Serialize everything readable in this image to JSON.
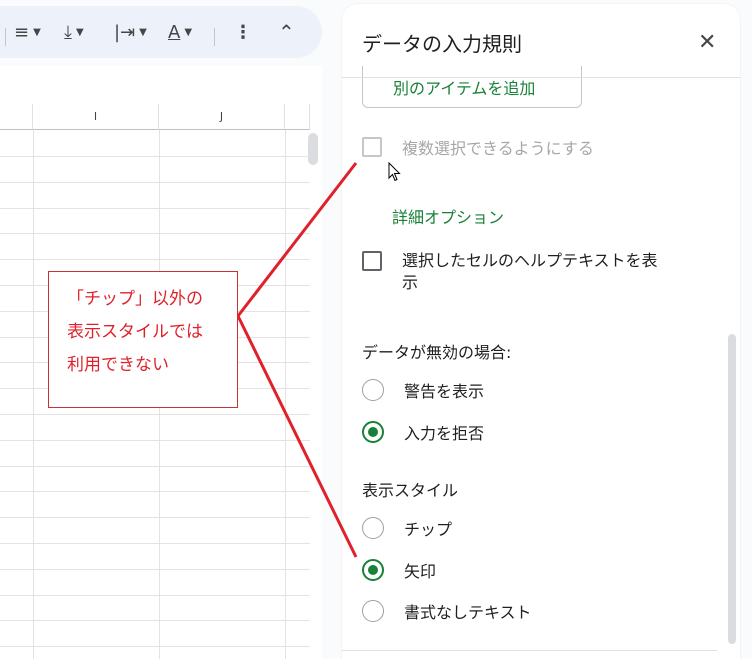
{
  "toolbar": {
    "items": [
      {
        "name": "align-icon",
        "glyph": "≡"
      },
      {
        "name": "vertical-align-icon",
        "glyph": "⤓"
      },
      {
        "name": "text-wrap-icon",
        "glyph": "|⇥"
      },
      {
        "name": "text-rotate-icon",
        "glyph": "A"
      },
      {
        "name": "more-vert-icon",
        "glyph": "⋮"
      },
      {
        "name": "collapse-icon",
        "glyph": "⌃"
      }
    ]
  },
  "sheet": {
    "columns": [
      "I",
      "J"
    ]
  },
  "panel": {
    "title": "データの入力規則",
    "close_glyph": "✕",
    "add_item_label": "別のアイテムを追加",
    "multi_select_label": "複数選択できるようにする",
    "advanced_options_label": "詳細オプション",
    "help_text_label_line1": "選択したセルのヘルプテキストを表",
    "help_text_label_line2": "示",
    "invalid_data_heading": "データが無効の場合:",
    "invalid_options": [
      {
        "label": "警告を表示",
        "selected": false
      },
      {
        "label": "入力を拒否",
        "selected": true
      }
    ],
    "display_style_heading": "表示スタイル",
    "display_options": [
      {
        "label": "チップ",
        "selected": false
      },
      {
        "label": "矢印",
        "selected": true
      },
      {
        "label": "書式なしテキスト",
        "selected": false
      }
    ]
  },
  "callout": {
    "line1": "「チップ」以外の",
    "line2": "表示スタイルでは",
    "line3": "利用できない"
  },
  "colors": {
    "accent_green": "#188038",
    "annotation_red": "#e0202a"
  }
}
